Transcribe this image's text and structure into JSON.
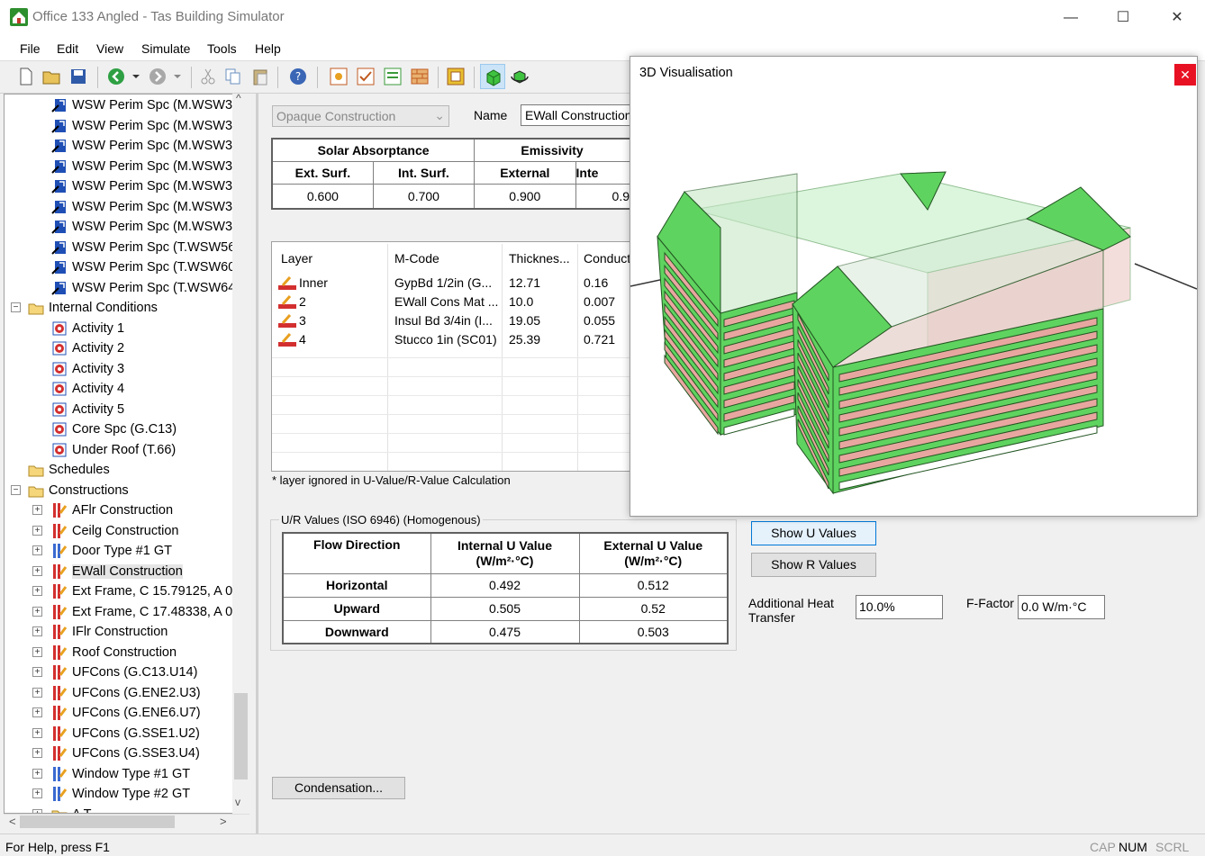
{
  "window": {
    "title": "Office 133 Angled - Tas Building Simulator",
    "minimize": "—",
    "maximize": "☐",
    "close": "✕"
  },
  "menu": [
    "File",
    "Edit",
    "View",
    "Simulate",
    "Tools",
    "Help"
  ],
  "tree": {
    "spaces": [
      "WSW Perim Spc (M.WSW3‹",
      "WSW Perim Spc (M.WSW3!",
      "WSW Perim Spc (M.WSW3!",
      "WSW Perim Spc (M.WSW3!",
      "WSW Perim Spc (M.WSW3!",
      "WSW Perim Spc (M.WSW3!",
      "WSW Perim Spc (M.WSW3!",
      "WSW Perim Spc (T.WSW56",
      "WSW Perim Spc (T.WSW60",
      "WSW Perim Spc (T.WSW64"
    ],
    "internal_conditions": "Internal Conditions",
    "conditions": [
      "Activity 1",
      "Activity 2",
      "Activity 3",
      "Activity 4",
      "Activity 5",
      "Core Spc (G.C13)",
      "Under Roof (T.66)"
    ],
    "schedules": "Schedules",
    "constructions_label": "Constructions",
    "constructions": [
      "AFlr Construction",
      "Ceilg Construction",
      "Door Type #1 GT",
      "EWall Construction",
      "Ext Frame, C 15.79125, A 0.",
      "Ext Frame, C 17.48338, A 0.",
      "IFlr Construction",
      "Roof Construction",
      "UFCons (G.C13.U14)",
      "UFCons (G.ENE2.U3)",
      "UFCons (G.ENE6.U7)",
      "UFCons (G.SSE1.U2)",
      "UFCons (G.SSE3.U4)",
      "Window Type #1 GT",
      "Window Type #2 GT"
    ],
    "partial_last": "A     T"
  },
  "form": {
    "type_combo": "Opaque Construction",
    "name_label": "Name",
    "name_value": "EWall Construction"
  },
  "absorptance": {
    "group1": "Solar Absorptance",
    "group2": "Emissivity",
    "headers": [
      "Ext. Surf.",
      "Int. Surf.",
      "External",
      "Inte"
    ],
    "values": [
      "0.600",
      "0.700",
      "0.900",
      "0.9"
    ]
  },
  "layers": {
    "headers": [
      "Layer",
      "M-Code",
      "Thicknes...",
      "Conducti"
    ],
    "rows": [
      [
        "Inner",
        "GypBd 1/2in (G...",
        "12.71",
        "0.16"
      ],
      [
        "2",
        "EWall Cons Mat ...",
        "10.0",
        "0.007"
      ],
      [
        "3",
        "Insul Bd 3/4in (I...",
        "19.05",
        "0.055"
      ],
      [
        "4",
        "Stucco 1in (SC01)",
        "25.39",
        "0.721"
      ]
    ]
  },
  "note": "* layer ignored in U-Value/R-Value Calculation",
  "uvalues": {
    "group_label": "U/R Values (ISO 6946) (Homogenous)",
    "col1": "Flow Direction",
    "col2a": "Internal U Value",
    "col2b": "(W/m²·°C)",
    "col3a": "External U Value",
    "col3b": "(W/m²·°C)",
    "rows": [
      [
        "Horizontal",
        "0.492",
        "0.512"
      ],
      [
        "Upward",
        "0.505",
        "0.52"
      ],
      [
        "Downward",
        "0.475",
        "0.503"
      ]
    ]
  },
  "buttons": {
    "show_u": "Show U Values",
    "show_r": "Show R Values",
    "condensation": "Condensation..."
  },
  "fields": {
    "aht_label_1": "Additional Heat",
    "aht_label_2": "Transfer",
    "aht_value": "10.0%",
    "ffactor_label": "F-Factor",
    "ffactor_value": "0.0 W/m·°C"
  },
  "vis": {
    "title": "3D Visualisation",
    "close": "✕"
  },
  "status": {
    "help": "For Help, press F1",
    "cap": "CAP",
    "num": "NUM",
    "scrl": "SCRL"
  },
  "colors": {
    "green": "#5fd35f",
    "pink": "#e8a6a0",
    "blue_icon": "#1f4fb5"
  }
}
